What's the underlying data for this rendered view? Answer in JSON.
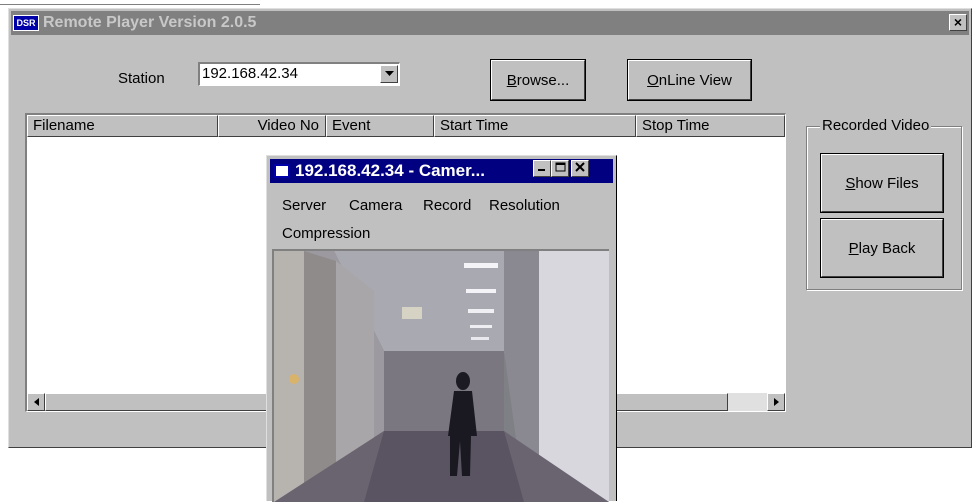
{
  "window": {
    "title": "Remote Player Version 2.0.5",
    "app_icon_text": "DSR",
    "close_glyph": "×"
  },
  "station": {
    "label": "Station",
    "value": "192.168.42.34"
  },
  "buttons": {
    "browse_prefix": "",
    "browse_u": "B",
    "browse_rest": "rowse...",
    "online_u": "O",
    "online_rest": "nLine View",
    "show_u": "S",
    "show_rest": "how Files",
    "play_u": "P",
    "play_rest": "lay Back"
  },
  "list": {
    "columns": [
      "Filename",
      "Video No",
      "Event",
      "Start Time",
      "Stop Time"
    ]
  },
  "group": {
    "label": "Recorded Video"
  },
  "camera_window": {
    "title": "192.168.42.34 - Camer...",
    "menu": [
      "Server",
      "Camera",
      "Record",
      "Resolution",
      "Compression"
    ]
  },
  "icons": {
    "close": "close-icon",
    "dropdown": "chevron-down-icon",
    "minimize": "minimize-icon",
    "maximize": "maximize-icon"
  }
}
